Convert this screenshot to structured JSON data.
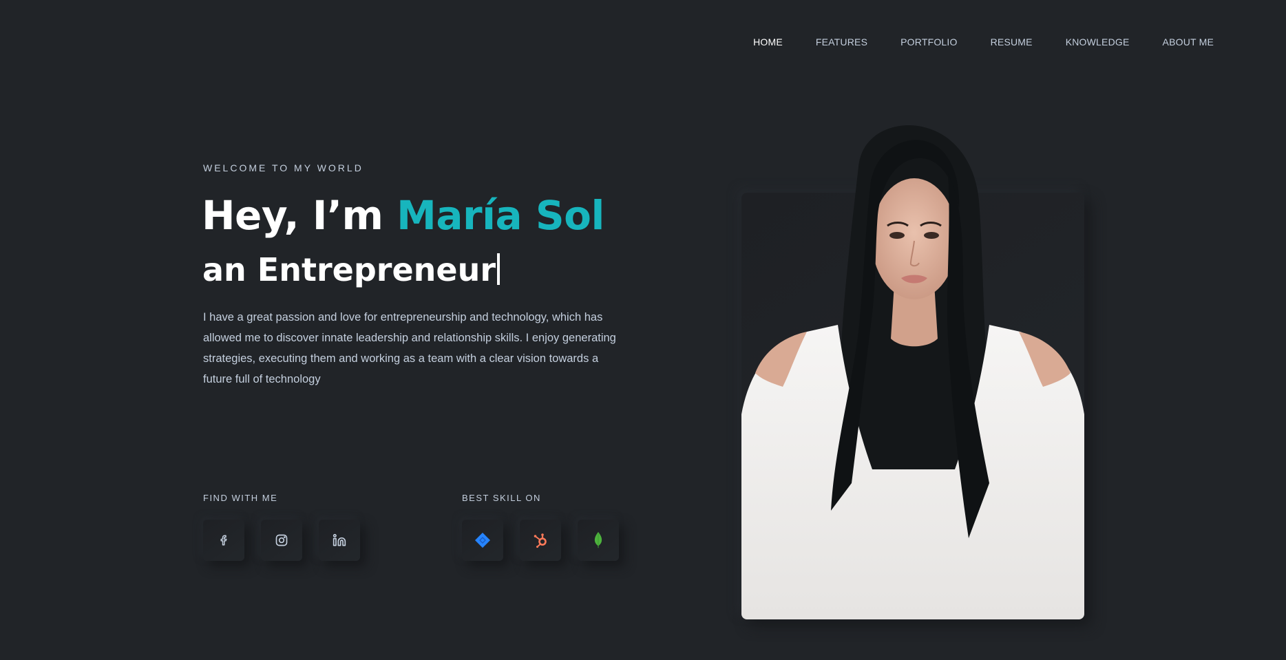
{
  "nav": {
    "items": [
      {
        "label": "HOME",
        "active": true
      },
      {
        "label": "FEATURES",
        "active": false
      },
      {
        "label": "PORTFOLIO",
        "active": false
      },
      {
        "label": "RESUME",
        "active": false
      },
      {
        "label": "KNOWLEDGE",
        "active": false
      },
      {
        "label": "ABOUT ME",
        "active": false
      }
    ]
  },
  "hero": {
    "eyebrow": "WELCOME TO MY WORLD",
    "greeting": "Hey, I’m ",
    "name": "María Sol",
    "role": "an Entrepreneur",
    "description": "I have a great passion and love for entrepreneurship and technology, which has allowed me to discover innate leadership and relationship skills. I enjoy generating strategies, executing them and working as a team with a clear vision towards a future full of technology"
  },
  "find_with_me": {
    "title": "FIND WITH ME",
    "icons": [
      "facebook-icon",
      "instagram-icon",
      "linkedin-icon"
    ]
  },
  "best_skill_on": {
    "title": "BEST SKILL ON",
    "icons": [
      "jira-icon",
      "hubspot-icon",
      "mongodb-icon"
    ]
  },
  "colors": {
    "background": "#212428",
    "accent": "#17b5bd",
    "text": "#c4cfde",
    "heading": "#ffffff",
    "jira": "#2684ff",
    "hubspot": "#ff7a59",
    "mongodb": "#4db33d"
  }
}
